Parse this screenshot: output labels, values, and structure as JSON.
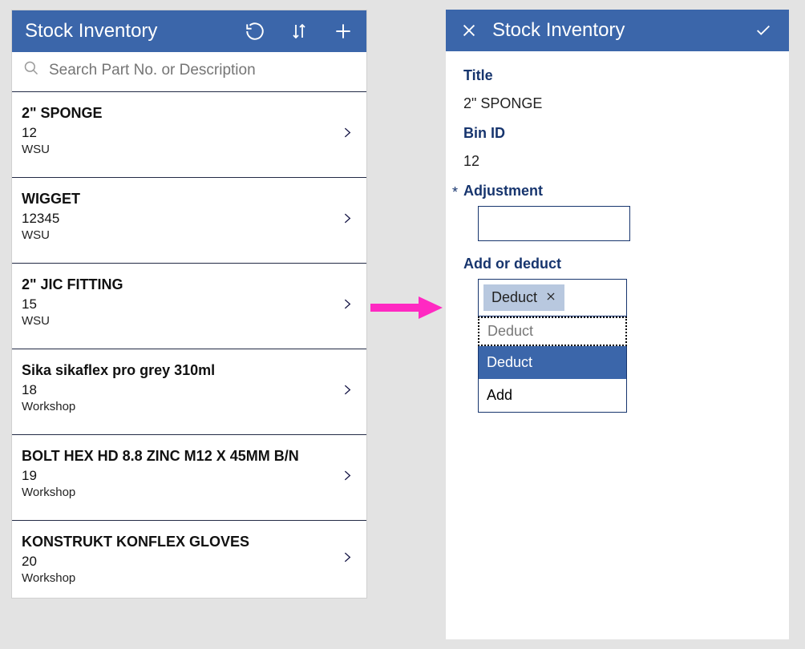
{
  "colors": {
    "primary": "#3b66aa",
    "labelNavy": "#17356e",
    "arrow": "#ff29c2"
  },
  "left": {
    "title": "Stock Inventory",
    "search_placeholder": "Search Part No. or Description",
    "items": [
      {
        "title": "2\" SPONGE",
        "sub": "12",
        "loc": "WSU"
      },
      {
        "title": "WIGGET",
        "sub": "12345",
        "loc": "WSU"
      },
      {
        "title": "2\" JIC FITTING",
        "sub": "15",
        "loc": "WSU"
      },
      {
        "title": "Sika sikaflex pro grey 310ml",
        "sub": "18",
        "loc": "Workshop"
      },
      {
        "title": "BOLT HEX HD 8.8 ZINC M12 X 45MM B/N",
        "sub": "19",
        "loc": "Workshop"
      },
      {
        "title": "KONSTRUKT KONFLEX GLOVES",
        "sub": "20",
        "loc": "Workshop"
      }
    ]
  },
  "right": {
    "title": "Stock Inventory",
    "labels": {
      "title": "Title",
      "bin": "Bin ID",
      "adjustment": "Adjustment",
      "add_or_deduct": "Add or deduct"
    },
    "values": {
      "title": "2\" SPONGE",
      "bin": "12",
      "adjustment": "",
      "chip": "Deduct",
      "ghost": "Deduct"
    },
    "options": [
      "Deduct",
      "Add"
    ],
    "selected_option_index": 0
  }
}
